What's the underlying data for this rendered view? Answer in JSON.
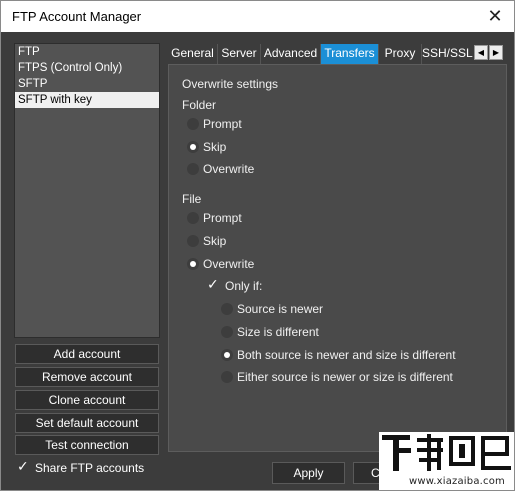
{
  "window": {
    "title": "FTP Account Manager"
  },
  "accounts": [
    "FTP",
    "FTPS (Control Only)",
    "SFTP",
    "SFTP with key"
  ],
  "selected_account_index": 3,
  "side_buttons": {
    "add": "Add account",
    "remove": "Remove account",
    "clone": "Clone account",
    "set_default": "Set default account",
    "test": "Test connection"
  },
  "share_label": "Share FTP accounts",
  "share_checked": true,
  "tabs": [
    "General",
    "Server",
    "Advanced",
    "Transfers",
    "Proxy",
    "SSH/SSL"
  ],
  "active_tab": "Transfers",
  "transfers": {
    "overwrite_settings": "Overwrite settings",
    "folder_label": "Folder",
    "folder_options": [
      "Prompt",
      "Skip",
      "Overwrite"
    ],
    "folder_selected": "Skip",
    "file_label": "File",
    "file_options": [
      "Prompt",
      "Skip",
      "Overwrite"
    ],
    "file_selected": "Overwrite",
    "only_if_label": "Only if:",
    "only_if_checked": true,
    "only_if_options": [
      "Source is newer",
      "Size is different",
      "Both source is newer and size is different",
      "Either source is newer or size is different"
    ],
    "only_if_selected": "Both source is newer and size is different"
  },
  "bottom_buttons": {
    "apply": "Apply",
    "cancel_partial": "C"
  },
  "watermark": {
    "url": "www.xiazaiba.com"
  }
}
